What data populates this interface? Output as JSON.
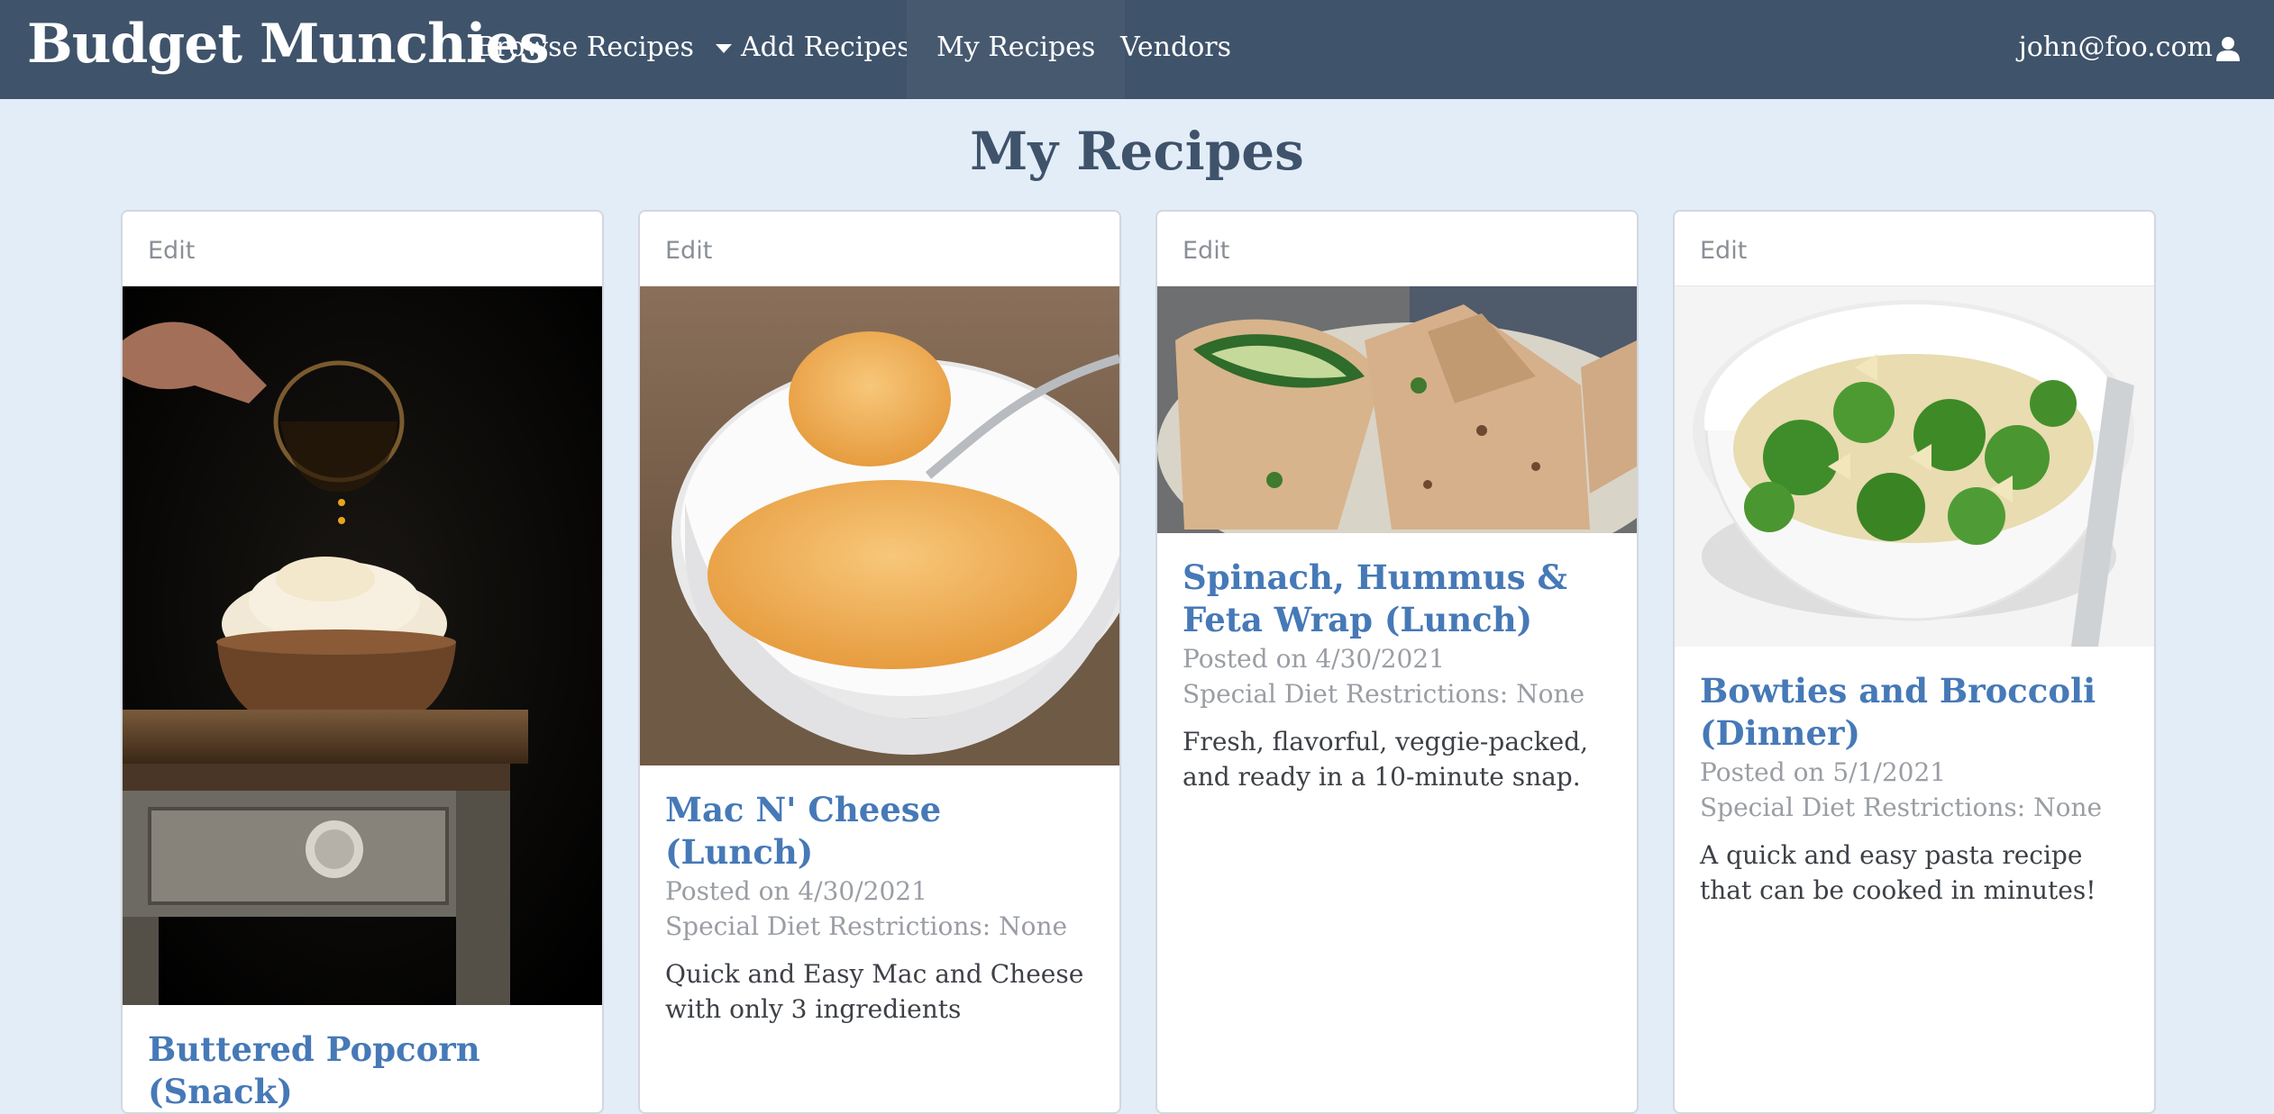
{
  "app": {
    "brand": "Budget Munchies",
    "nav": [
      {
        "label": "Browse Recipes",
        "dropdown": true
      },
      {
        "label": "Add Recipes"
      },
      {
        "label": "My Recipes",
        "active": true
      },
      {
        "label": "Vendors"
      }
    ],
    "user_email": "john@foo.com",
    "user_icon": "user-icon"
  },
  "page": {
    "title": "My Recipes"
  },
  "recipes": [
    {
      "edit_label": "Edit",
      "image": "popcorn-photo",
      "title": "Buttered Popcorn (Snack)",
      "posted": "",
      "diet": "",
      "description": ""
    },
    {
      "edit_label": "Edit",
      "image": "mac-and-cheese-photo",
      "title": "Mac N' Cheese (Lunch)",
      "posted": "Posted on 4/30/2021",
      "diet": "Special Diet Restrictions: None",
      "description": "Quick and Easy Mac and Cheese with only 3 ingredients"
    },
    {
      "edit_label": "Edit",
      "image": "wrap-photo",
      "title": "Spinach, Hummus & Feta Wrap (Lunch)",
      "posted": "Posted on 4/30/2021",
      "diet": "Special Diet Restrictions: None",
      "description": "Fresh, flavorful, veggie-packed, and ready in a 10-minute snap."
    },
    {
      "edit_label": "Edit",
      "image": "bowties-broccoli-photo",
      "title": "Bowties and Broccoli (Dinner)",
      "posted": "Posted on 5/1/2021",
      "diet": "Special Diet Restrictions: None",
      "description": "A quick and easy pasta recipe that can be cooked in minutes!"
    }
  ],
  "colors": {
    "navbar": "#3f536b",
    "background": "#e3edf8",
    "title_link": "#4679b7"
  }
}
